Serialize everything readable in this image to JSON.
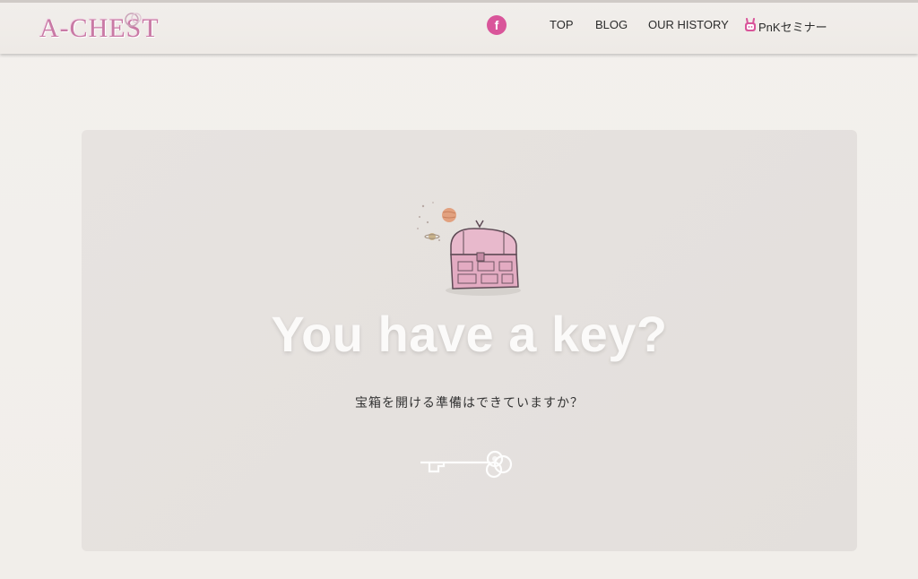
{
  "header": {
    "logo_text": "A-CHEST",
    "nav": {
      "top": "TOP",
      "blog": "BLOG",
      "history": "OUR HISTORY",
      "seminar": "PnKセミナー"
    },
    "facebook_glyph": "f"
  },
  "hero": {
    "headline": "You have a key?",
    "subtitle": "宝箱を開ける準備はできていますか？"
  },
  "icons": {
    "facebook": "facebook-icon",
    "seminar": "pnk-bunny-icon",
    "chest": "treasure-chest-icon",
    "key": "key-icon"
  },
  "colors": {
    "brand_pink": "#d9559a",
    "background": "#f1eeea",
    "panel": "#e5e1de",
    "headline": "#fbfaf9"
  }
}
